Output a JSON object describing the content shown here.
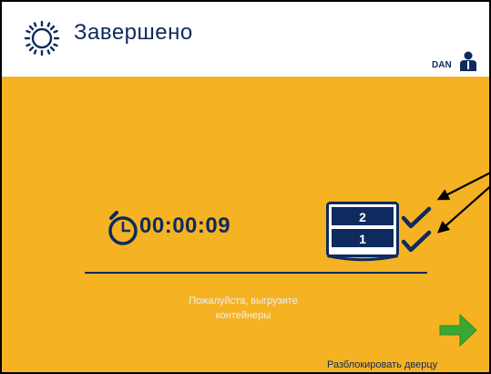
{
  "header": {
    "icon": "sun-icon",
    "title": "Завершено",
    "user": {
      "label": "DAN",
      "icon": "user-icon"
    }
  },
  "status": {
    "icon": "stopwatch-icon",
    "elapsed": "00:00:09"
  },
  "containers": {
    "icon": "container-stack-icon",
    "items": [
      {
        "number": "2",
        "status": "check-icon"
      },
      {
        "number": "1",
        "status": "check-icon"
      }
    ]
  },
  "message": {
    "line1": "Пожалуйста, выгрузите",
    "line2": "контейнеры"
  },
  "actions": {
    "unlock_icon": "arrow-right-icon",
    "unlock_label": "Разблокировать дверцу"
  },
  "colors": {
    "background": "#f5b223",
    "header": "#ffffff",
    "text": "#0e2a5e",
    "arrow": "#3aa832"
  }
}
